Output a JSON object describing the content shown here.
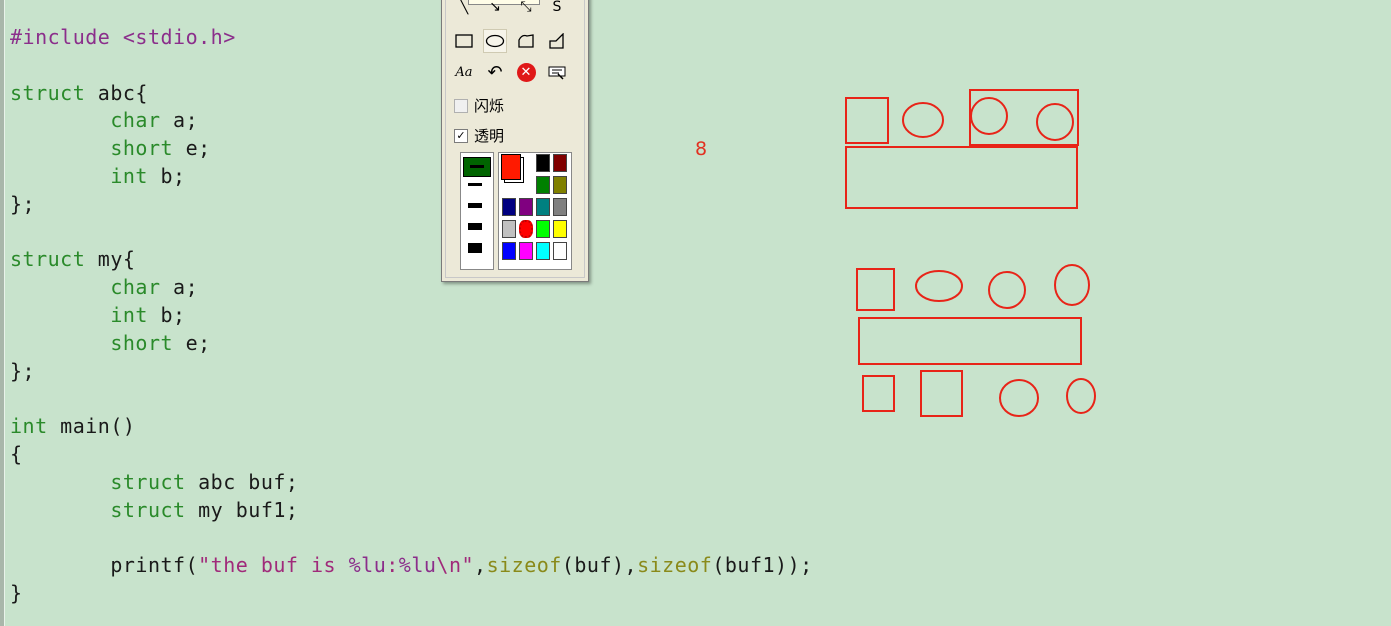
{
  "editor": {
    "lines": [
      [
        {
          "t": "#include <stdio.h>",
          "c": "pp"
        }
      ],
      [],
      [
        {
          "t": "struct",
          "c": "ty"
        },
        {
          "t": " abc{"
        }
      ],
      [
        {
          "t": "        "
        },
        {
          "t": "char",
          "c": "ty"
        },
        {
          "t": " a;"
        }
      ],
      [
        {
          "t": "        "
        },
        {
          "t": "short",
          "c": "ty"
        },
        {
          "t": " e;"
        }
      ],
      [
        {
          "t": "        "
        },
        {
          "t": "int",
          "c": "ty"
        },
        {
          "t": " b;"
        }
      ],
      [
        {
          "t": "};"
        }
      ],
      [],
      [
        {
          "t": "struct",
          "c": "ty"
        },
        {
          "t": " my{"
        }
      ],
      [
        {
          "t": "        "
        },
        {
          "t": "char",
          "c": "ty"
        },
        {
          "t": " a;"
        }
      ],
      [
        {
          "t": "        "
        },
        {
          "t": "int",
          "c": "ty"
        },
        {
          "t": " b;"
        }
      ],
      [
        {
          "t": "        "
        },
        {
          "t": "short",
          "c": "ty"
        },
        {
          "t": " e;"
        }
      ],
      [
        {
          "t": "};"
        }
      ],
      [],
      [
        {
          "t": "int",
          "c": "ty"
        },
        {
          "t": " main()"
        }
      ],
      [
        {
          "t": "{"
        }
      ],
      [
        {
          "t": "        "
        },
        {
          "t": "struct",
          "c": "ty"
        },
        {
          "t": " abc buf;"
        }
      ],
      [
        {
          "t": "        "
        },
        {
          "t": "struct",
          "c": "ty"
        },
        {
          "t": " my buf1;"
        }
      ],
      [],
      [
        {
          "t": "        printf("
        },
        {
          "t": "\"the buf is ",
          "c": "str"
        },
        {
          "t": "%lu",
          "c": "fmt"
        },
        {
          "t": ":",
          "c": "str"
        },
        {
          "t": "%lu",
          "c": "fmt"
        },
        {
          "t": "\\n\"",
          "c": "str"
        },
        {
          "t": ","
        },
        {
          "t": "sizeof",
          "c": "fn"
        },
        {
          "t": "(buf),"
        },
        {
          "t": "sizeof",
          "c": "fn"
        },
        {
          "t": "(buf1));"
        }
      ],
      [
        {
          "t": "}"
        }
      ]
    ]
  },
  "annotation": {
    "number": "8",
    "color": "#e23020"
  },
  "palette": {
    "tools_row1": [
      "line-icon",
      "arrow-icon",
      "double-arrow-icon",
      "curve-icon"
    ],
    "tools_row1_glyphs": [
      "╲",
      "↘",
      "⤡",
      "S"
    ],
    "tools_row2": [
      "rectangle-icon",
      "ellipse-icon",
      "freeform-shape-icon",
      "polygon-icon"
    ],
    "tools_row3": [
      "text-tool-icon",
      "undo-icon",
      "clear-icon",
      "eraser-icon"
    ],
    "text_tool_glyph": "Aa",
    "undo_glyph": "↶",
    "clear_glyph": "✕",
    "flash_label": "闪烁",
    "flash_checked": false,
    "transparent_label": "透明",
    "transparent_checked": true,
    "check_glyph": "✓",
    "current_color": "#ff1a00",
    "colors": [
      [
        "#000000",
        "#800000"
      ],
      [
        "#008000",
        "#808000"
      ],
      [
        "#000080",
        "#800080",
        "#008080",
        "#808080"
      ],
      [
        "#c0c0c0",
        "#ff0000",
        "#00ff00",
        "#ffff00"
      ],
      [
        "#0000ff",
        "#ff00ff",
        "#00ffff",
        "#ffffff"
      ]
    ],
    "selected_width_color": "#006400"
  }
}
